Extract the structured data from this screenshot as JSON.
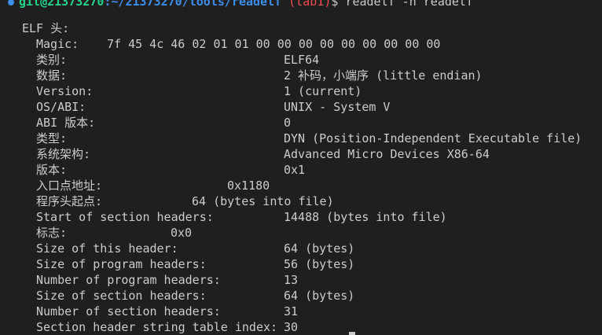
{
  "colors": {
    "background": "#1f1f1f",
    "text": "#cccccc",
    "user": "#23d18b",
    "path": "#3b8eea",
    "branch": "#f14c4c",
    "status_dot": "#3b8eea"
  },
  "prompt": {
    "status_icon": "circle-dot-icon",
    "user_host": "git@21373270",
    "path": ":~/21373270/tools/readelf",
    "branch": " (lab1)",
    "suffix": "$ ",
    "command": "readelf -h readelf"
  },
  "header_title": "ELF 头:",
  "magic": {
    "label": "Magic:",
    "value": "7f 45 4c 46 02 01 01 00 00 00 00 00 00 00 00 00"
  },
  "fields": [
    {
      "label": "类别:",
      "value": "ELF64"
    },
    {
      "label": "数据:",
      "value": "2 补码，小端序 (little endian)"
    },
    {
      "label": "Version:",
      "value": "1 (current)"
    },
    {
      "label": "OS/ABI:",
      "value": "UNIX - System V"
    },
    {
      "label": "ABI 版本:",
      "value": "0"
    },
    {
      "label": "类型:",
      "value": "DYN (Position-Independent Executable file)"
    },
    {
      "label": "系统架构:",
      "value": "Advanced Micro Devices X86-64"
    },
    {
      "label": "版本:",
      "value": "0x1"
    },
    {
      "label": "入口点地址:",
      "value": "0x1180"
    },
    {
      "label": "程序头起点:",
      "value": "64 (bytes into file)"
    },
    {
      "label": "Start of section headers:",
      "value": "14488 (bytes into file)"
    },
    {
      "label": "标志:",
      "value": "0x0"
    },
    {
      "label": "Size of this header:",
      "value": "64 (bytes)"
    },
    {
      "label": "Size of program headers:",
      "value": "56 (bytes)"
    },
    {
      "label": "Number of program headers:",
      "value": "13"
    },
    {
      "label": "Size of section headers:",
      "value": "64 (bytes)"
    },
    {
      "label": "Number of section headers:",
      "value": "31"
    },
    {
      "label": "Section header string table index:",
      "value": "30"
    }
  ]
}
